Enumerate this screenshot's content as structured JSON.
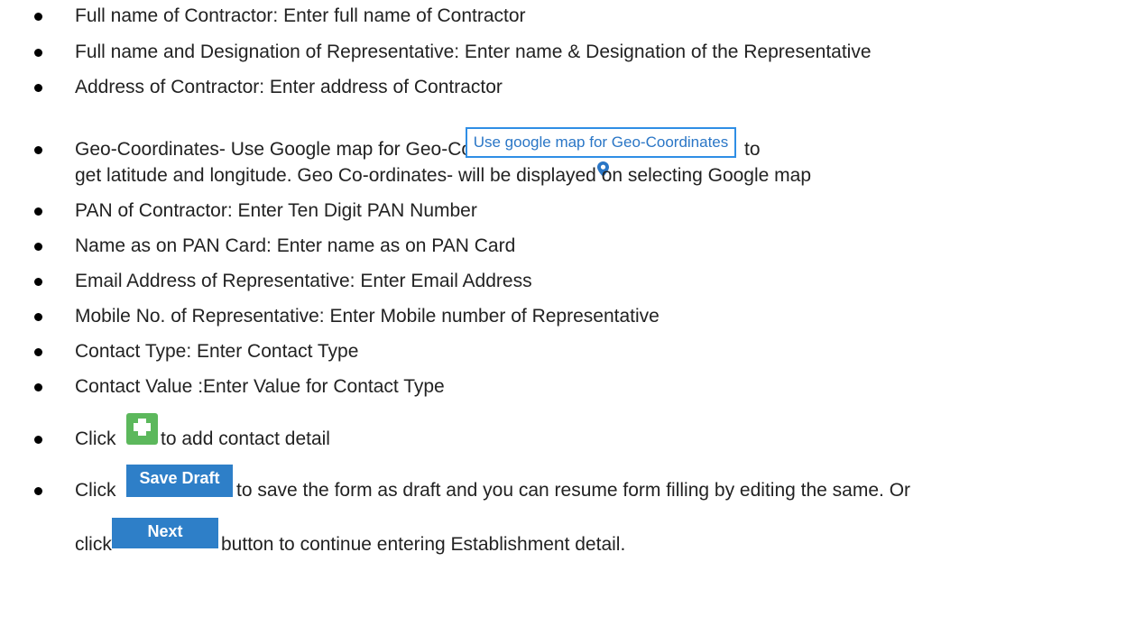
{
  "items": [
    {
      "text": "Full name of Contractor: Enter full name of Contractor"
    },
    {
      "text": "Full name and Designation of Representative: Enter name & Designation of the Representative"
    },
    {
      "text": "Address of Contractor: Enter address of Contractor"
    },
    {
      "before": "Geo-Coordinates- Use Google map for Geo-Coordinates- click",
      "after": "to",
      "line2": "get latitude and longitude. Geo Co-ordinates- will be displayed on selecting Google map",
      "button_label": "Use google map for Geo-Coordinates",
      "button_icon": "map-marker-icon"
    },
    {
      "text": "PAN of Contractor: Enter Ten Digit PAN Number"
    },
    {
      "text": "Name as on PAN Card: Enter name as on PAN Card"
    },
    {
      "text": "Email Address of Representative: Enter Email Address"
    },
    {
      "text": "Mobile No. of Representative: Enter Mobile number of Representative"
    },
    {
      "text": "Contact Type: Enter Contact Type"
    },
    {
      "text": "Contact Value :Enter Value for Contact Type"
    },
    {
      "before": "Click",
      "after": "to add contact detail",
      "button_icon": "plus-icon"
    },
    {
      "before": "Click",
      "after": "to save the form as draft and you can resume form filling by editing the same. Or",
      "button_label": "Save Draft",
      "line2_before": "click",
      "line2_after": "button to continue entering Establishment detail.",
      "button2_label": "Next"
    }
  ],
  "colors": {
    "geo_button_border": "#2f8ee5",
    "geo_button_text": "#2a76c6",
    "add_button": "#5cb85c",
    "blue_button": "#2e7fc8"
  }
}
